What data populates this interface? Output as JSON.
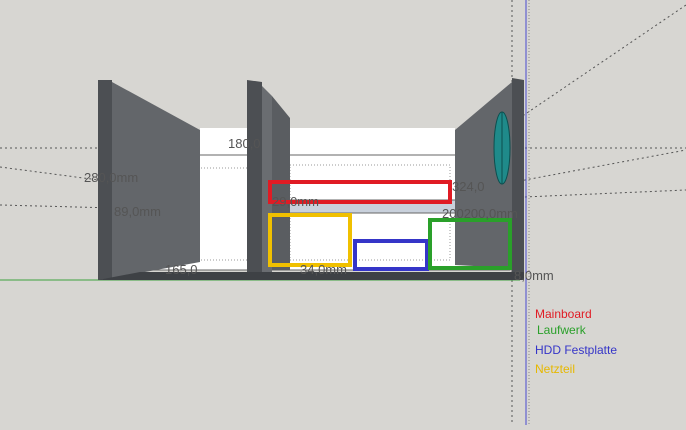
{
  "dimensions": {
    "d180": "180,0",
    "d280": "280,0mm",
    "d89": "89,0mm",
    "d29": "29,0mm",
    "d324": "324,0",
    "d200": "200200,0mm",
    "d34": "34,0mm",
    "d165": "165,0",
    "d8": "8,0mm"
  },
  "legend": [
    {
      "label": "Mainboard",
      "color": "#e01b24"
    },
    {
      "label": "Laufwerk",
      "color": "#2aa02a"
    },
    {
      "label": "HDD Festplatte",
      "color": "#3535c8"
    },
    {
      "label": "Netzteil",
      "color": "#f0c000"
    }
  ],
  "colors": {
    "background": "#d7d6d2",
    "panel_dark": "#5a5d61",
    "panel_mid": "#8a8d90",
    "fan": "#1f8a8a"
  }
}
